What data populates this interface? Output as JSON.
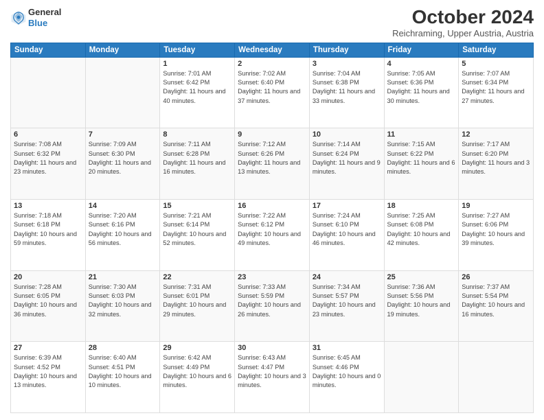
{
  "header": {
    "logo_line1": "General",
    "logo_line2": "Blue",
    "month": "October 2024",
    "location": "Reichraming, Upper Austria, Austria"
  },
  "weekdays": [
    "Sunday",
    "Monday",
    "Tuesday",
    "Wednesday",
    "Thursday",
    "Friday",
    "Saturday"
  ],
  "weeks": [
    [
      {
        "day": "",
        "empty": true
      },
      {
        "day": "",
        "empty": true
      },
      {
        "day": "1",
        "sunrise": "Sunrise: 7:01 AM",
        "sunset": "Sunset: 6:42 PM",
        "daylight": "Daylight: 11 hours and 40 minutes."
      },
      {
        "day": "2",
        "sunrise": "Sunrise: 7:02 AM",
        "sunset": "Sunset: 6:40 PM",
        "daylight": "Daylight: 11 hours and 37 minutes."
      },
      {
        "day": "3",
        "sunrise": "Sunrise: 7:04 AM",
        "sunset": "Sunset: 6:38 PM",
        "daylight": "Daylight: 11 hours and 33 minutes."
      },
      {
        "day": "4",
        "sunrise": "Sunrise: 7:05 AM",
        "sunset": "Sunset: 6:36 PM",
        "daylight": "Daylight: 11 hours and 30 minutes."
      },
      {
        "day": "5",
        "sunrise": "Sunrise: 7:07 AM",
        "sunset": "Sunset: 6:34 PM",
        "daylight": "Daylight: 11 hours and 27 minutes."
      }
    ],
    [
      {
        "day": "6",
        "sunrise": "Sunrise: 7:08 AM",
        "sunset": "Sunset: 6:32 PM",
        "daylight": "Daylight: 11 hours and 23 minutes."
      },
      {
        "day": "7",
        "sunrise": "Sunrise: 7:09 AM",
        "sunset": "Sunset: 6:30 PM",
        "daylight": "Daylight: 11 hours and 20 minutes."
      },
      {
        "day": "8",
        "sunrise": "Sunrise: 7:11 AM",
        "sunset": "Sunset: 6:28 PM",
        "daylight": "Daylight: 11 hours and 16 minutes."
      },
      {
        "day": "9",
        "sunrise": "Sunrise: 7:12 AM",
        "sunset": "Sunset: 6:26 PM",
        "daylight": "Daylight: 11 hours and 13 minutes."
      },
      {
        "day": "10",
        "sunrise": "Sunrise: 7:14 AM",
        "sunset": "Sunset: 6:24 PM",
        "daylight": "Daylight: 11 hours and 9 minutes."
      },
      {
        "day": "11",
        "sunrise": "Sunrise: 7:15 AM",
        "sunset": "Sunset: 6:22 PM",
        "daylight": "Daylight: 11 hours and 6 minutes."
      },
      {
        "day": "12",
        "sunrise": "Sunrise: 7:17 AM",
        "sunset": "Sunset: 6:20 PM",
        "daylight": "Daylight: 11 hours and 3 minutes."
      }
    ],
    [
      {
        "day": "13",
        "sunrise": "Sunrise: 7:18 AM",
        "sunset": "Sunset: 6:18 PM",
        "daylight": "Daylight: 10 hours and 59 minutes."
      },
      {
        "day": "14",
        "sunrise": "Sunrise: 7:20 AM",
        "sunset": "Sunset: 6:16 PM",
        "daylight": "Daylight: 10 hours and 56 minutes."
      },
      {
        "day": "15",
        "sunrise": "Sunrise: 7:21 AM",
        "sunset": "Sunset: 6:14 PM",
        "daylight": "Daylight: 10 hours and 52 minutes."
      },
      {
        "day": "16",
        "sunrise": "Sunrise: 7:22 AM",
        "sunset": "Sunset: 6:12 PM",
        "daylight": "Daylight: 10 hours and 49 minutes."
      },
      {
        "day": "17",
        "sunrise": "Sunrise: 7:24 AM",
        "sunset": "Sunset: 6:10 PM",
        "daylight": "Daylight: 10 hours and 46 minutes."
      },
      {
        "day": "18",
        "sunrise": "Sunrise: 7:25 AM",
        "sunset": "Sunset: 6:08 PM",
        "daylight": "Daylight: 10 hours and 42 minutes."
      },
      {
        "day": "19",
        "sunrise": "Sunrise: 7:27 AM",
        "sunset": "Sunset: 6:06 PM",
        "daylight": "Daylight: 10 hours and 39 minutes."
      }
    ],
    [
      {
        "day": "20",
        "sunrise": "Sunrise: 7:28 AM",
        "sunset": "Sunset: 6:05 PM",
        "daylight": "Daylight: 10 hours and 36 minutes."
      },
      {
        "day": "21",
        "sunrise": "Sunrise: 7:30 AM",
        "sunset": "Sunset: 6:03 PM",
        "daylight": "Daylight: 10 hours and 32 minutes."
      },
      {
        "day": "22",
        "sunrise": "Sunrise: 7:31 AM",
        "sunset": "Sunset: 6:01 PM",
        "daylight": "Daylight: 10 hours and 29 minutes."
      },
      {
        "day": "23",
        "sunrise": "Sunrise: 7:33 AM",
        "sunset": "Sunset: 5:59 PM",
        "daylight": "Daylight: 10 hours and 26 minutes."
      },
      {
        "day": "24",
        "sunrise": "Sunrise: 7:34 AM",
        "sunset": "Sunset: 5:57 PM",
        "daylight": "Daylight: 10 hours and 23 minutes."
      },
      {
        "day": "25",
        "sunrise": "Sunrise: 7:36 AM",
        "sunset": "Sunset: 5:56 PM",
        "daylight": "Daylight: 10 hours and 19 minutes."
      },
      {
        "day": "26",
        "sunrise": "Sunrise: 7:37 AM",
        "sunset": "Sunset: 5:54 PM",
        "daylight": "Daylight: 10 hours and 16 minutes."
      }
    ],
    [
      {
        "day": "27",
        "sunrise": "Sunrise: 6:39 AM",
        "sunset": "Sunset: 4:52 PM",
        "daylight": "Daylight: 10 hours and 13 minutes."
      },
      {
        "day": "28",
        "sunrise": "Sunrise: 6:40 AM",
        "sunset": "Sunset: 4:51 PM",
        "daylight": "Daylight: 10 hours and 10 minutes."
      },
      {
        "day": "29",
        "sunrise": "Sunrise: 6:42 AM",
        "sunset": "Sunset: 4:49 PM",
        "daylight": "Daylight: 10 hours and 6 minutes."
      },
      {
        "day": "30",
        "sunrise": "Sunrise: 6:43 AM",
        "sunset": "Sunset: 4:47 PM",
        "daylight": "Daylight: 10 hours and 3 minutes."
      },
      {
        "day": "31",
        "sunrise": "Sunrise: 6:45 AM",
        "sunset": "Sunset: 4:46 PM",
        "daylight": "Daylight: 10 hours and 0 minutes."
      },
      {
        "day": "",
        "empty": true
      },
      {
        "day": "",
        "empty": true
      }
    ]
  ]
}
